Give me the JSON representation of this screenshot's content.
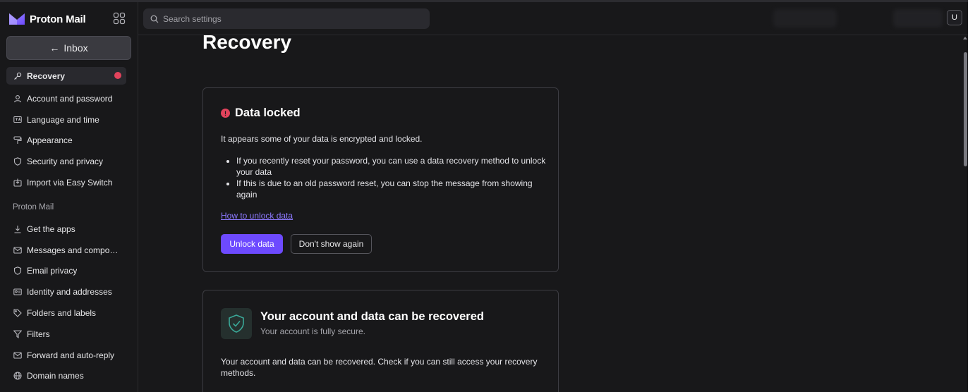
{
  "app": {
    "name": "Proton Mail"
  },
  "sidebar": {
    "back_button": "Inbox",
    "account_items": [
      {
        "label": "Recovery",
        "icon": "key-icon",
        "active": true,
        "badge": "alert-dot"
      },
      {
        "label": "Account and password",
        "icon": "user-icon"
      },
      {
        "label": "Language and time",
        "icon": "language-icon"
      },
      {
        "label": "Appearance",
        "icon": "paint-roller-icon"
      },
      {
        "label": "Security and privacy",
        "icon": "shield-icon"
      },
      {
        "label": "Import via Easy Switch",
        "icon": "import-icon"
      }
    ],
    "section_title": "Proton Mail",
    "mail_items": [
      {
        "label": "Get the apps",
        "icon": "download-icon"
      },
      {
        "label": "Messages and composi...",
        "icon": "envelope-icon"
      },
      {
        "label": "Email privacy",
        "icon": "shield-icon"
      },
      {
        "label": "Identity and addresses",
        "icon": "id-card-icon"
      },
      {
        "label": "Folders and labels",
        "icon": "tag-icon"
      },
      {
        "label": "Filters",
        "icon": "filter-icon"
      },
      {
        "label": "Forward and auto-reply",
        "icon": "envelope-icon"
      },
      {
        "label": "Domain names",
        "icon": "globe-icon"
      }
    ]
  },
  "header": {
    "search_placeholder": "Search settings",
    "avatar_initial": "U"
  },
  "main": {
    "title": "Recovery",
    "data_locked": {
      "title": "Data locked",
      "intro": "It appears some of your data is encrypted and locked.",
      "bullets": [
        "If you recently reset your password, you can use a data recovery method to unlock your data",
        "If this is due to an old password reset, you can stop the message from showing again"
      ],
      "link": "How to unlock data",
      "primary_button": "Unlock data",
      "secondary_button": "Don't show again"
    },
    "recovery_status": {
      "title": "Your account and data can be recovered",
      "subtitle": "Your account is fully secure.",
      "text": "Your account and data can be recovered. Check if you can still access your recovery methods."
    }
  },
  "colors": {
    "background": "#18181a",
    "accent": "#6d4aff",
    "danger": "#e2435c",
    "link": "#8d79ff",
    "success": "#3aa898"
  }
}
